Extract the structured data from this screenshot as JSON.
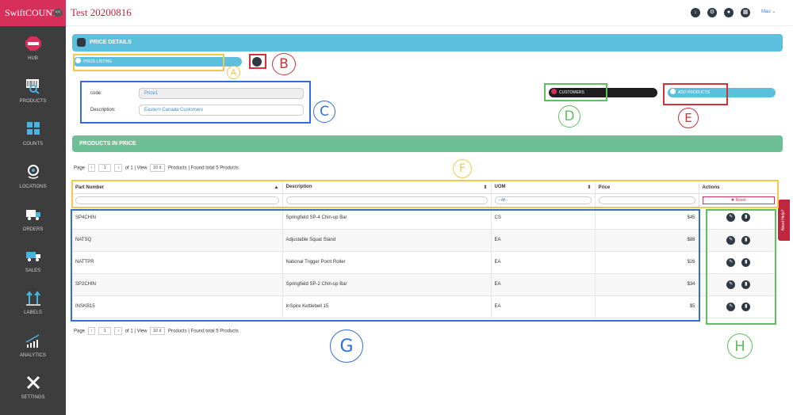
{
  "app": {
    "logo": "SwiftCOUNT",
    "collapse": "<<",
    "title": "Test 20200816",
    "user": "Mau ⌄"
  },
  "sidebar": [
    "HUB",
    "PRODUCTS",
    "COUNTS",
    "LOCATIONS",
    "ORDERS",
    "SALES",
    "LABELS",
    "ANALYTICS",
    "SETTINGS"
  ],
  "price_details": {
    "title": "PRICE DETAILS",
    "price_listing": "PRICE LISTING",
    "code_label": "code:",
    "code_value": "Price1",
    "desc_label": "Description:",
    "desc_value": "Eastern Canada Customers",
    "customers": "CUSTOMERS",
    "add_products": "ADD PRODUCTS"
  },
  "products": {
    "title": "PRODUCTS IN PRICE"
  },
  "pager": {
    "page": "Page",
    "page_num": "1",
    "of": "of 1 | View",
    "view": "10 ⇕",
    "found": "Products | Found total 5 Products"
  },
  "table": {
    "headers": [
      "Part Number",
      "Description",
      "UOM",
      "Price",
      "Actions"
    ],
    "uom_filter": "--All--",
    "reset": "✖ Reset",
    "rows": [
      {
        "part": "SP4CHIN",
        "desc": "Springfield SP-4 Chin-up Bar",
        "uom": "CS",
        "price": "$45"
      },
      {
        "part": "NATSQ",
        "desc": "Adjustable Squat Stand",
        "uom": "EA",
        "price": "$88"
      },
      {
        "part": "NATTPR",
        "desc": "National Trigger Point Roller",
        "uom": "EA",
        "price": "$26"
      },
      {
        "part": "SP2CHIN",
        "desc": "Springfield SP-2 Chin-up Bar",
        "uom": "EA",
        "price": "$34"
      },
      {
        "part": "INSKB15",
        "desc": "InSpire Kettlebell 15",
        "uom": "EA",
        "price": "$5"
      }
    ]
  },
  "need_help": "Need Help?",
  "annotations": [
    "A",
    "B",
    "C",
    "D",
    "E",
    "F",
    "G",
    "H"
  ]
}
